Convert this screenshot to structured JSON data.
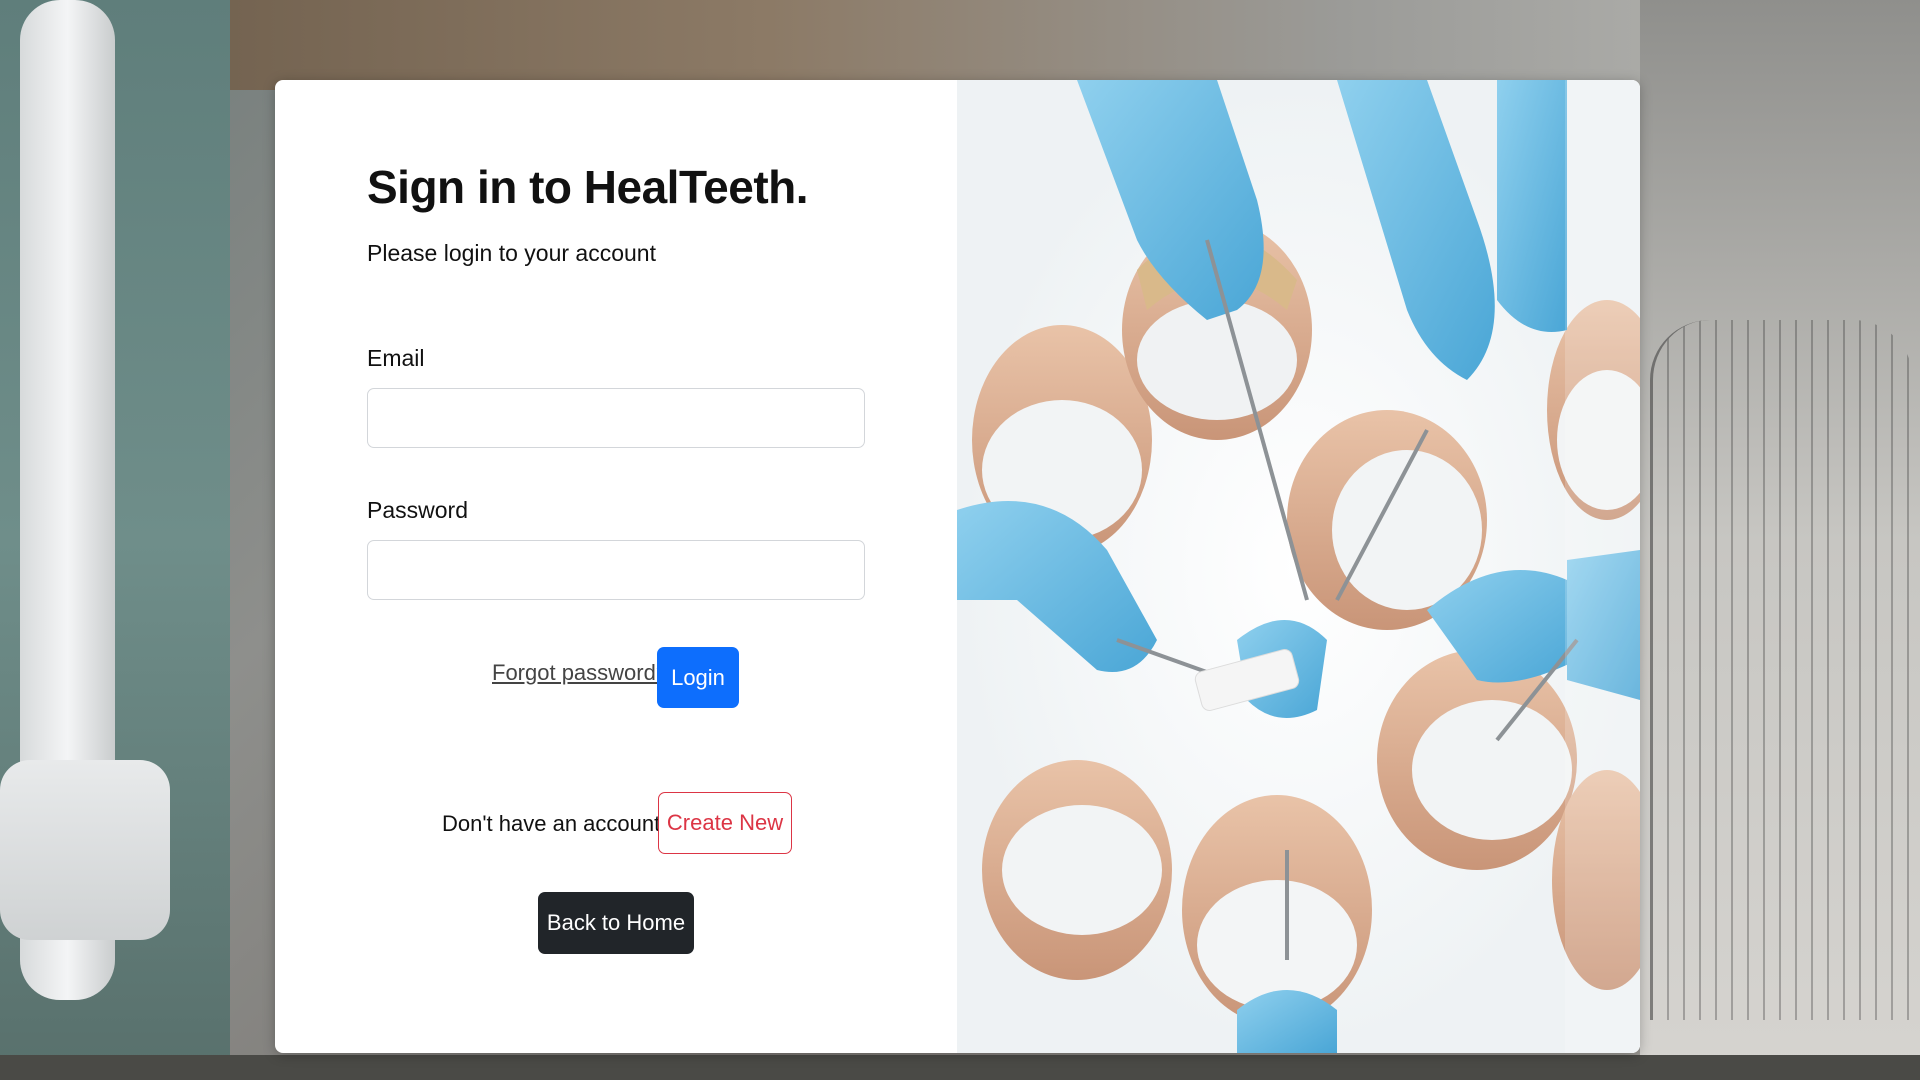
{
  "login": {
    "title": "Sign in to HealTeeth.",
    "subtitle": "Please login to your account",
    "email_label": "Email",
    "email_value": "",
    "password_label": "Password",
    "password_value": "",
    "forgot_password": "Forgot password?",
    "login_button": "Login",
    "no_account_text": "Don't have an account?",
    "create_new_button": "Create New",
    "back_home_button": "Back to Home"
  },
  "colors": {
    "primary": "#0d6efd",
    "danger": "#dc3545",
    "dark": "#212529",
    "glove": "#6ec0e6"
  },
  "icons": {
    "hero_image": "dentists-team-looking-down-illustration"
  }
}
